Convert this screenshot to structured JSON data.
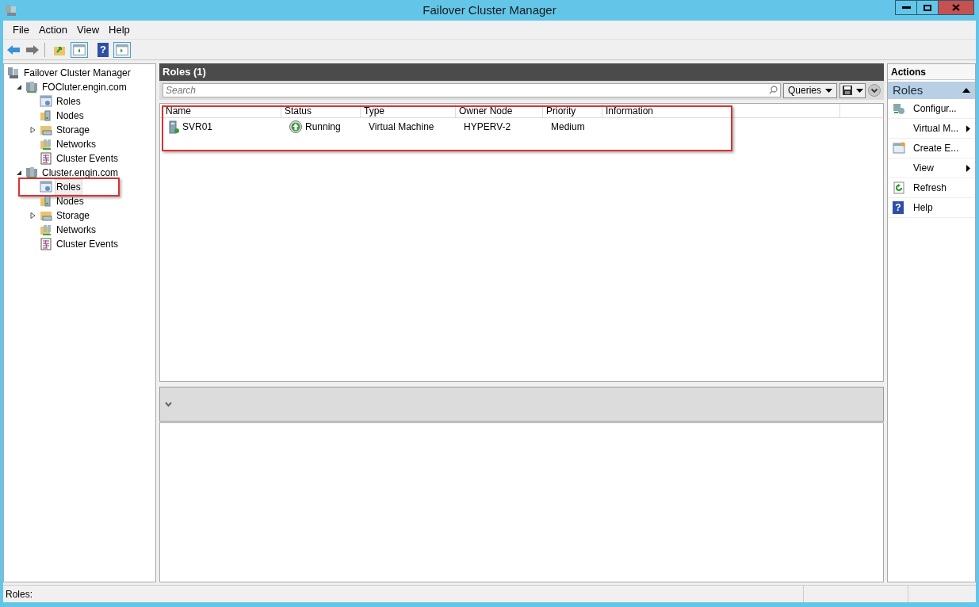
{
  "window": {
    "title": "Failover Cluster Manager"
  },
  "menu": [
    "File",
    "Action",
    "View",
    "Help"
  ],
  "toolbar": {
    "help_glyph": "?"
  },
  "tree": [
    {
      "label": "Failover Cluster Manager",
      "kind": "manager",
      "selected": false,
      "children": [
        {
          "label": "FOCluter.engin.com",
          "kind": "cluster",
          "selected": false,
          "expanded": true,
          "children": [
            {
              "label": "Roles",
              "kind": "roles",
              "selected": false
            },
            {
              "label": "Nodes",
              "kind": "nodes",
              "selected": false
            },
            {
              "label": "Storage",
              "kind": "storage",
              "selected": false,
              "expanded": false
            },
            {
              "label": "Networks",
              "kind": "networks",
              "selected": false
            },
            {
              "label": "Cluster Events",
              "kind": "events",
              "selected": false
            }
          ]
        },
        {
          "label": "Cluster.engin.com",
          "kind": "cluster",
          "selected": false,
          "expanded": true,
          "children": [
            {
              "label": "Roles",
              "kind": "roles",
              "selected": true,
              "annotated": true
            },
            {
              "label": "Nodes",
              "kind": "nodes",
              "selected": false
            },
            {
              "label": "Storage",
              "kind": "storage",
              "selected": false,
              "expanded": false
            },
            {
              "label": "Networks",
              "kind": "networks",
              "selected": false
            },
            {
              "label": "Cluster Events",
              "kind": "events",
              "selected": false
            }
          ]
        }
      ]
    }
  ],
  "center": {
    "title": "Roles (1)",
    "search": {
      "placeholder": "Search"
    },
    "queries_button": "Queries",
    "table": {
      "annotated": true,
      "columns": [
        "Name",
        "Status",
        "Type",
        "Owner Node",
        "Priority",
        "Information"
      ],
      "rows": [
        {
          "cells": [
            "SVR01",
            "Running",
            "Virtual Machine",
            "HYPERV-2",
            "Medium",
            ""
          ]
        }
      ]
    }
  },
  "actions": {
    "title": "Actions",
    "section": "Roles",
    "items": [
      {
        "label": "Configur...",
        "kind": "configure"
      },
      {
        "label": "Virtual M...",
        "kind": "none",
        "submenu": true
      },
      {
        "label": "Create E...",
        "kind": "create"
      },
      {
        "label": "View",
        "kind": "none",
        "submenu": true
      },
      {
        "label": "Refresh",
        "kind": "refresh"
      },
      {
        "label": "Help",
        "kind": "help",
        "glyph": "?"
      }
    ]
  },
  "status_bar": "Roles:"
}
